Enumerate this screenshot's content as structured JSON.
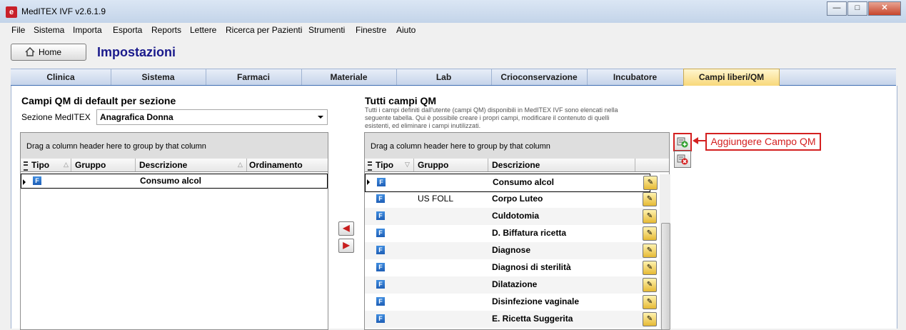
{
  "window": {
    "title": "MedITEX IVF v2.6.1.9",
    "controls": [
      "—",
      "□",
      "✕"
    ]
  },
  "menu": [
    "File",
    "Sistema",
    "Importa",
    "Esporta",
    "Reports",
    "Lettere",
    "Ricerca per Pazienti",
    "Strumenti",
    "Finestre",
    "Aiuto"
  ],
  "home_button": "Home",
  "page_title": "Impostazioni",
  "tabs": [
    "Clinica",
    "Sistema",
    "Farmaci",
    "Materiale",
    "Lab",
    "Crioconservazione",
    "Incubatore",
    "Campi liberi/QM"
  ],
  "left": {
    "title": "Campi QM di default per sezione",
    "section_label": "Sezione MedITEX",
    "section_value": "Anagrafica Donna",
    "group_hint": "Drag a column header here to group by that column",
    "columns": [
      "Tipo",
      "Gruppo",
      "Descrizione",
      "Ordinamento"
    ],
    "rows": [
      {
        "tipo": "F",
        "gruppo": "",
        "descrizione": "Consumo alcol",
        "ordinamento": ""
      }
    ]
  },
  "right": {
    "title": "Tutti campi QM",
    "description": "Tutti i campi definiti dall'utente (campi QM) disponibili in MedITEX IVF sono elencati nella seguente tabella. Qui è possibile creare i propri campi, modificare il contenuto di quelli esistenti, ed eliminare i campi inutilizzati.",
    "group_hint": "Drag a column header here to group by that column",
    "columns": [
      "Tipo",
      "Gruppo",
      "Descrizione"
    ],
    "rows": [
      {
        "tipo": "F",
        "gruppo": "",
        "descrizione": "Consumo alcol"
      },
      {
        "tipo": "F",
        "gruppo": "US FOLL",
        "descrizione": "Corpo Luteo"
      },
      {
        "tipo": "F",
        "gruppo": "",
        "descrizione": "Culdotomia"
      },
      {
        "tipo": "F",
        "gruppo": "",
        "descrizione": "D. Biffatura ricetta"
      },
      {
        "tipo": "F",
        "gruppo": "",
        "descrizione": "Diagnose"
      },
      {
        "tipo": "F",
        "gruppo": "",
        "descrizione": "Diagnosi di sterilità"
      },
      {
        "tipo": "F",
        "gruppo": "",
        "descrizione": "Dilatazione"
      },
      {
        "tipo": "F",
        "gruppo": "",
        "descrizione": "Disinfezione vaginale"
      },
      {
        "tipo": "F",
        "gruppo": "",
        "descrizione": "E. Ricetta Suggerita"
      }
    ]
  },
  "callout": "Aggiungere Campo QM"
}
